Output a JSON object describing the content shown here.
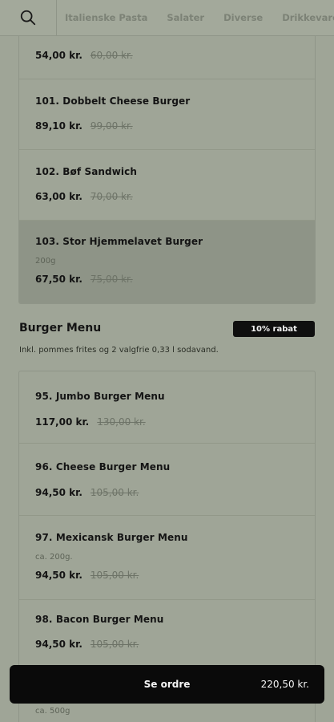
{
  "nav": {
    "tabs": [
      "Italienske Pasta",
      "Salater",
      "Diverse",
      "Drikkevarer"
    ]
  },
  "section1": {
    "items": [
      {
        "name": "",
        "desc": "",
        "price": "54,00 kr.",
        "old": "60,00 kr."
      },
      {
        "name": "101. Dobbelt Cheese Burger",
        "desc": "",
        "price": "89,10 kr.",
        "old": "99,00 kr."
      },
      {
        "name": "102. Bøf Sandwich",
        "desc": "",
        "price": "63,00 kr.",
        "old": "70,00 kr."
      },
      {
        "name": "103. Stor Hjemmelavet Burger",
        "desc": "200g",
        "price": "67,50 kr.",
        "old": "75,00 kr."
      }
    ]
  },
  "burger_menu": {
    "title": "Burger Menu",
    "badge": "10% rabat",
    "desc": "Inkl. pommes frites og 2 valgfrie 0,33 l sodavand.",
    "items": [
      {
        "name": "95. Jumbo Burger Menu",
        "desc": "",
        "price": "117,00 kr.",
        "old": "130,00 kr."
      },
      {
        "name": "96. Cheese Burger Menu",
        "desc": "",
        "price": "94,50 kr.",
        "old": "105,00 kr."
      },
      {
        "name": "97. Mexicansk Burger Menu",
        "desc": "ca. 200g.",
        "price": "94,50 kr.",
        "old": "105,00 kr."
      },
      {
        "name": "98. Bacon Burger Menu",
        "desc": "",
        "price": "94,50 kr.",
        "old": "105,00 kr."
      },
      {
        "name": "",
        "desc": "ca. 500g",
        "price": "",
        "old": ""
      }
    ]
  },
  "order": {
    "label": "Se ordre",
    "total": "220,50 kr."
  },
  "colors": {
    "background": "#9fa597",
    "order_bar": "#0a0a0a",
    "badge": "#0f0f0f"
  }
}
